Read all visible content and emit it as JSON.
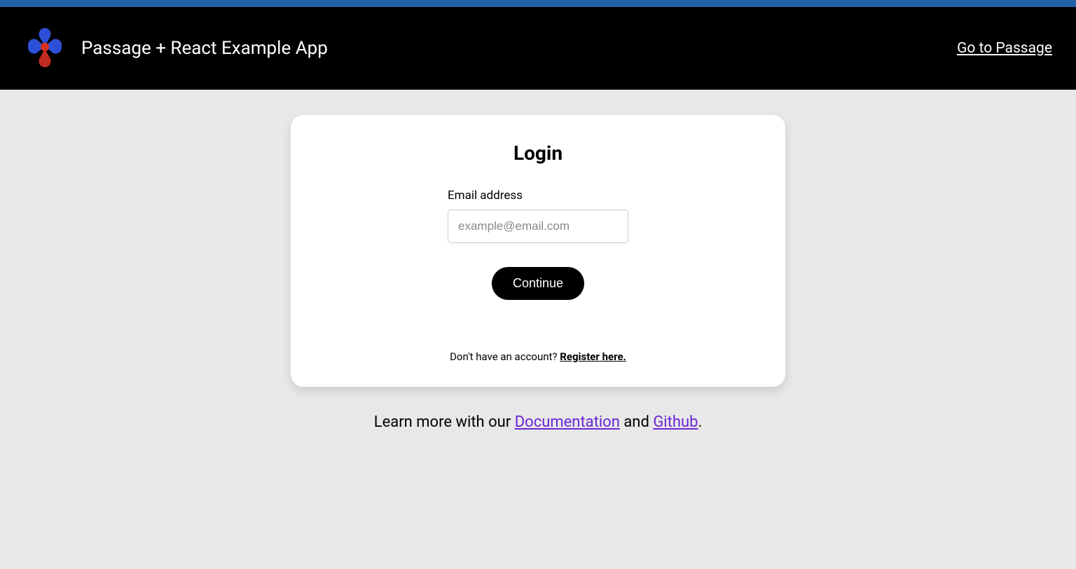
{
  "header": {
    "title": "Passage + React Example App",
    "go_link": "Go to Passage"
  },
  "card": {
    "title": "Login",
    "email_label": "Email address",
    "email_placeholder": "example@email.com",
    "continue_label": "Continue",
    "no_account_text": "Don't have an account? ",
    "register_label": "Register here."
  },
  "footer": {
    "prefix": "Learn more with our ",
    "doc_label": "Documentation",
    "and": " and ",
    "github_label": "Github",
    "suffix": "."
  }
}
